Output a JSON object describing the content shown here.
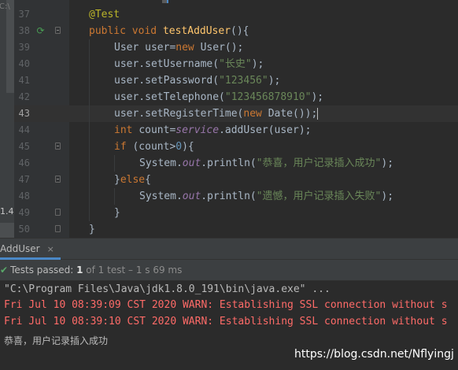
{
  "editor": {
    "current_line": 43,
    "lines": [
      {
        "num": "37",
        "indent": 0,
        "tokens": [
          {
            "t": "@Test",
            "c": "ann"
          }
        ]
      },
      {
        "num": "38",
        "indent": 0,
        "icon": "run",
        "fold": "open",
        "tokens": [
          {
            "t": "public ",
            "c": "kw"
          },
          {
            "t": "void ",
            "c": "kw"
          },
          {
            "t": "testAddUser",
            "c": "fn"
          },
          {
            "t": "(){",
            "c": ""
          }
        ]
      },
      {
        "num": "39",
        "indent": 1,
        "tokens": [
          {
            "t": "User user=",
            "c": ""
          },
          {
            "t": "new ",
            "c": "kw"
          },
          {
            "t": "User();",
            "c": ""
          }
        ]
      },
      {
        "num": "40",
        "indent": 1,
        "tokens": [
          {
            "t": "user.setUsername(",
            "c": ""
          },
          {
            "t": "\"长史\"",
            "c": "str"
          },
          {
            "t": ");",
            "c": ""
          }
        ]
      },
      {
        "num": "41",
        "indent": 1,
        "tokens": [
          {
            "t": "user.setPassword(",
            "c": ""
          },
          {
            "t": "\"123456\"",
            "c": "str"
          },
          {
            "t": ");",
            "c": ""
          }
        ]
      },
      {
        "num": "42",
        "indent": 1,
        "tokens": [
          {
            "t": "user.setTelephone(",
            "c": ""
          },
          {
            "t": "\"123456878910\"",
            "c": "str"
          },
          {
            "t": ");",
            "c": ""
          }
        ]
      },
      {
        "num": "43",
        "indent": 1,
        "tokens": [
          {
            "t": "user.setRegisterTime(",
            "c": ""
          },
          {
            "t": "new ",
            "c": "kw"
          },
          {
            "t": "Date());",
            "c": ""
          },
          {
            "t": "",
            "c": "cursor"
          }
        ]
      },
      {
        "num": "44",
        "indent": 1,
        "tokens": [
          {
            "t": "int ",
            "c": "kw"
          },
          {
            "t": "count=",
            "c": ""
          },
          {
            "t": "service",
            "c": "field"
          },
          {
            "t": ".addUser(user);",
            "c": ""
          }
        ]
      },
      {
        "num": "45",
        "indent": 1,
        "fold": "open",
        "tokens": [
          {
            "t": "if ",
            "c": "kw"
          },
          {
            "t": "(count>",
            "c": ""
          },
          {
            "t": "0",
            "c": "num-lit"
          },
          {
            "t": "){",
            "c": ""
          }
        ]
      },
      {
        "num": "46",
        "indent": 2,
        "tokens": [
          {
            "t": "System.",
            "c": ""
          },
          {
            "t": "out",
            "c": "field"
          },
          {
            "t": ".println(",
            "c": ""
          },
          {
            "t": "\"恭喜，用户记录插入成功\"",
            "c": "str"
          },
          {
            "t": ");",
            "c": ""
          }
        ]
      },
      {
        "num": "47",
        "indent": 1,
        "fold": "open",
        "tokens": [
          {
            "t": "}",
            "c": ""
          },
          {
            "t": "else",
            "c": "kw"
          },
          {
            "t": "{",
            "c": ""
          }
        ]
      },
      {
        "num": "48",
        "indent": 2,
        "tokens": [
          {
            "t": "System.",
            "c": ""
          },
          {
            "t": "out",
            "c": "field"
          },
          {
            "t": ".println(",
            "c": ""
          },
          {
            "t": "\"遗憾，用户记录插入失败\"",
            "c": "str"
          },
          {
            "t": ");",
            "c": ""
          }
        ]
      },
      {
        "num": "49",
        "indent": 1,
        "fold": "close",
        "tokens": [
          {
            "t": "}",
            "c": ""
          }
        ]
      },
      {
        "num": "50",
        "indent": 0,
        "fold": "close",
        "tokens": [
          {
            "t": "}",
            "c": ""
          }
        ]
      }
    ]
  },
  "left_strip": {
    "side_label": "1.4",
    "top_label": "C:\\"
  },
  "run_panel": {
    "tab_label": "AddUser",
    "tab_close": "×",
    "status": {
      "passed_label": "Tests passed:",
      "passed_count": "1",
      "of_total": "of 1 test",
      "duration": "– 1 s 69 ms"
    },
    "console": [
      {
        "text": "\"C:\\Program Files\\Java\\jdk1.8.0_191\\bin\\java.exe\" ...",
        "style": "gray"
      },
      {
        "text": "Fri Jul 10 08:39:09 CST 2020 WARN: Establishing SSL connection without s",
        "style": "red"
      },
      {
        "text": "Fri Jul 10 08:39:10 CST 2020 WARN: Establishing SSL connection without s",
        "style": "red"
      },
      {
        "text": "恭喜，用户记录插入成功",
        "style": "plain"
      }
    ]
  },
  "watermark": "https://blog.csdn.net/Nflyingj",
  "colors": {
    "editor_bg": "#2b2b2b",
    "gutter_bg": "#313335",
    "keyword": "#cc7832",
    "string": "#6a8759",
    "function": "#ffc66d",
    "annotation": "#bbb529",
    "number": "#6897bb",
    "field": "#9876aa",
    "error_text": "#ff6b68",
    "success": "#59a869"
  },
  "icons": {
    "run_gutter": "run-test-icon",
    "test_passed": "check-icon",
    "fold": "fold-marker-icon",
    "close": "close-icon"
  }
}
